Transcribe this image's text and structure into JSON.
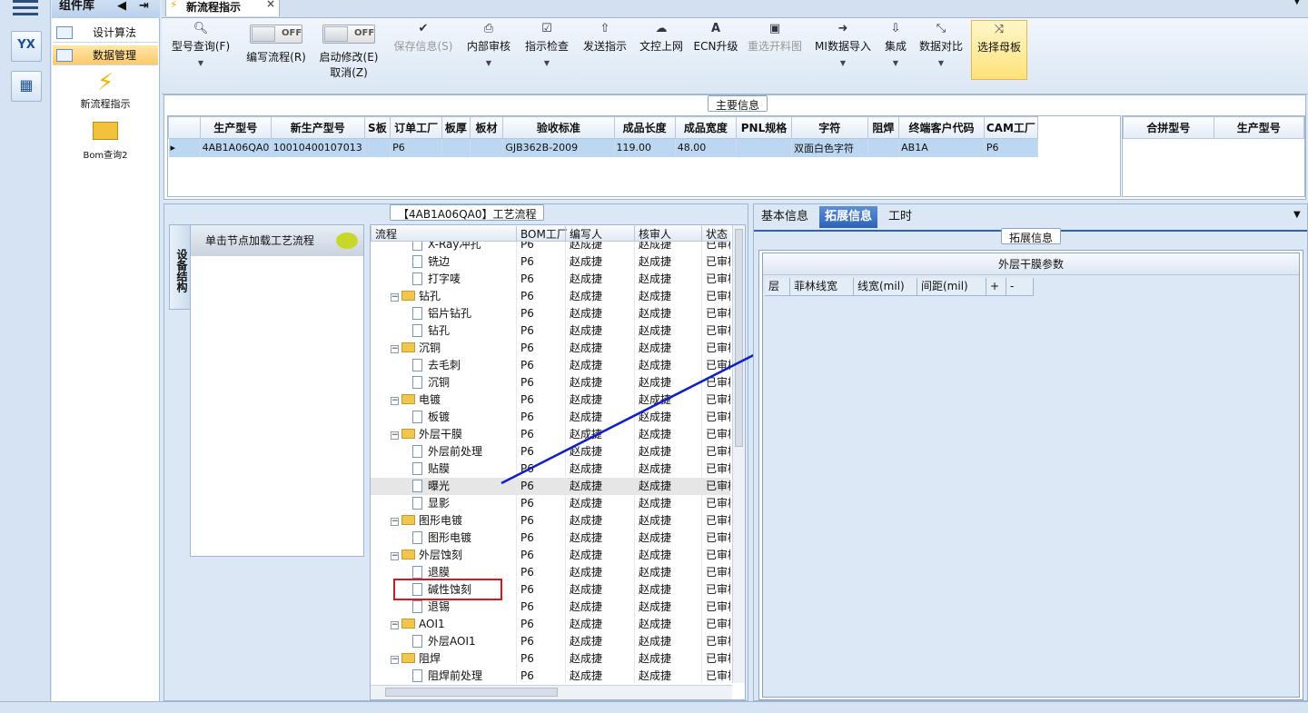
{
  "sidebar": {
    "title": "组件库",
    "icon_label": "YX",
    "items": [
      {
        "label": "设计算法"
      },
      {
        "label": "数据管理"
      }
    ],
    "shortcuts": [
      {
        "label": "新流程指示"
      },
      {
        "label": "Bom查询2"
      }
    ]
  },
  "tabs": {
    "active": "新流程指示"
  },
  "ribbon": {
    "btn_model_query": "型号查询(F)",
    "toggle_edit_off": "OFF",
    "btn_edit_flow": "编写流程(R)",
    "toggle_start_off": "OFF",
    "btn_start_modify": "启动修改(E)",
    "btn_cancel": "取消(Z)",
    "btn_save_info": "保存信息(S)",
    "btn_internal_review": "内部审核",
    "btn_indicator_check": "指示检查",
    "btn_send_indicator": "发送指示",
    "btn_doc_upload": "文控上网",
    "btn_ecn_upgrade": "ECN升级",
    "btn_reselect_material": "重选开料图",
    "btn_mi_import": "MI数据导入",
    "btn_integrate": "集成",
    "btn_data_compare": "数据对比",
    "btn_select_mother": "选择母板"
  },
  "main_info": {
    "title": "主要信息",
    "columns": [
      "生产型号",
      "新生产型号",
      "S板",
      "订单工厂",
      "板厚",
      "板材",
      "验收标准",
      "成品长度",
      "成品宽度",
      "PNL规格",
      "字符",
      "阻焊",
      "终端客户代码",
      "CAM工厂"
    ],
    "rows": [
      [
        "4AB1A06QA0",
        "10010400107013",
        "",
        "P6",
        "",
        "",
        "GJB362B-2009",
        "119.00",
        "48.00",
        "",
        "双面白色字符",
        "",
        "AB1A",
        "P6"
      ]
    ],
    "side_columns": [
      "合拼型号",
      "生产型号"
    ]
  },
  "process": {
    "title": "【4AB1A06QA0】工艺流程",
    "vertical_tab": "设备结构",
    "click_hint": "单击节点加载工艺流程",
    "columns": [
      "流程",
      "BOM工厂",
      "编写人",
      "核审人",
      "状态"
    ],
    "rows": [
      {
        "name": "X-Ray冲孔",
        "type": "doc",
        "factory": "P6",
        "writer": "赵成捷",
        "reviewer": "赵成捷",
        "status": "已审核"
      },
      {
        "name": "铣边",
        "type": "doc",
        "factory": "P6",
        "writer": "赵成捷",
        "reviewer": "赵成捷",
        "status": "已审核"
      },
      {
        "name": "打字唛",
        "type": "doc",
        "factory": "P6",
        "writer": "赵成捷",
        "reviewer": "赵成捷",
        "status": "已审核"
      },
      {
        "name": "钻孔",
        "type": "folder",
        "factory": "P6",
        "writer": "赵成捷",
        "reviewer": "赵成捷",
        "status": "已审核"
      },
      {
        "name": "铝片钻孔",
        "type": "doc",
        "factory": "P6",
        "writer": "赵成捷",
        "reviewer": "赵成捷",
        "status": "已审核"
      },
      {
        "name": "钻孔",
        "type": "doc",
        "factory": "P6",
        "writer": "赵成捷",
        "reviewer": "赵成捷",
        "status": "已审核"
      },
      {
        "name": "沉铜",
        "type": "folder",
        "factory": "P6",
        "writer": "赵成捷",
        "reviewer": "赵成捷",
        "status": "已审核"
      },
      {
        "name": "去毛刺",
        "type": "doc",
        "factory": "P6",
        "writer": "赵成捷",
        "reviewer": "赵成捷",
        "status": "已审核"
      },
      {
        "name": "沉铜",
        "type": "doc",
        "factory": "P6",
        "writer": "赵成捷",
        "reviewer": "赵成捷",
        "status": "已审核"
      },
      {
        "name": "电镀",
        "type": "folder",
        "factory": "P6",
        "writer": "赵成捷",
        "reviewer": "赵成捷",
        "status": "已审核"
      },
      {
        "name": "板镀",
        "type": "doc",
        "factory": "P6",
        "writer": "赵成捷",
        "reviewer": "赵成捷",
        "status": "已审核"
      },
      {
        "name": "外层干膜",
        "type": "folder",
        "factory": "P6",
        "writer": "赵成捷",
        "reviewer": "赵成捷",
        "status": "已审核"
      },
      {
        "name": "外层前处理",
        "type": "doc",
        "factory": "P6",
        "writer": "赵成捷",
        "reviewer": "赵成捷",
        "status": "已审核"
      },
      {
        "name": "贴膜",
        "type": "doc",
        "factory": "P6",
        "writer": "赵成捷",
        "reviewer": "赵成捷",
        "status": "已审核"
      },
      {
        "name": "曝光",
        "type": "doc",
        "factory": "P6",
        "writer": "赵成捷",
        "reviewer": "赵成捷",
        "status": "已审核",
        "selected": true
      },
      {
        "name": "显影",
        "type": "doc",
        "factory": "P6",
        "writer": "赵成捷",
        "reviewer": "赵成捷",
        "status": "已审核"
      },
      {
        "name": "图形电镀",
        "type": "folder",
        "factory": "P6",
        "writer": "赵成捷",
        "reviewer": "赵成捷",
        "status": "已审核"
      },
      {
        "name": "图形电镀",
        "type": "doc",
        "factory": "P6",
        "writer": "赵成捷",
        "reviewer": "赵成捷",
        "status": "已审核"
      },
      {
        "name": "外层蚀刻",
        "type": "folder",
        "factory": "P6",
        "writer": "赵成捷",
        "reviewer": "赵成捷",
        "status": "已审核"
      },
      {
        "name": "退膜",
        "type": "doc",
        "factory": "P6",
        "writer": "赵成捷",
        "reviewer": "赵成捷",
        "status": "已审核"
      },
      {
        "name": "碱性蚀刻",
        "type": "doc",
        "factory": "P6",
        "writer": "赵成捷",
        "reviewer": "赵成捷",
        "status": "已审核",
        "highlight": true
      },
      {
        "name": "退锡",
        "type": "doc",
        "factory": "P6",
        "writer": "赵成捷",
        "reviewer": "赵成捷",
        "status": "已审核"
      },
      {
        "name": "AOI1",
        "type": "folder",
        "factory": "P6",
        "writer": "赵成捷",
        "reviewer": "赵成捷",
        "status": "已审核"
      },
      {
        "name": "外层AOI1",
        "type": "doc",
        "factory": "P6",
        "writer": "赵成捷",
        "reviewer": "赵成捷",
        "status": "已审核"
      },
      {
        "name": "阻焊",
        "type": "folder",
        "factory": "P6",
        "writer": "赵成捷",
        "reviewer": "赵成捷",
        "status": "已审核"
      },
      {
        "name": "阻焊前处理",
        "type": "doc",
        "factory": "P6",
        "writer": "赵成捷",
        "reviewer": "赵成捷",
        "status": "已审核"
      }
    ]
  },
  "right": {
    "tabs": [
      "基本信息",
      "拓展信息",
      "工时"
    ],
    "active_tab": "拓展信息",
    "panel_title": "拓展信息",
    "table_title": "外层干膜参数",
    "columns": [
      "层",
      "菲林线宽",
      "线宽(mil)",
      "间距(mil)",
      "+",
      "-"
    ]
  },
  "colors": {
    "accent": "#2d62b8",
    "arrow": "#1020c8",
    "highlight_box": "#e0141c",
    "selected_row": "#bcd7f2"
  }
}
